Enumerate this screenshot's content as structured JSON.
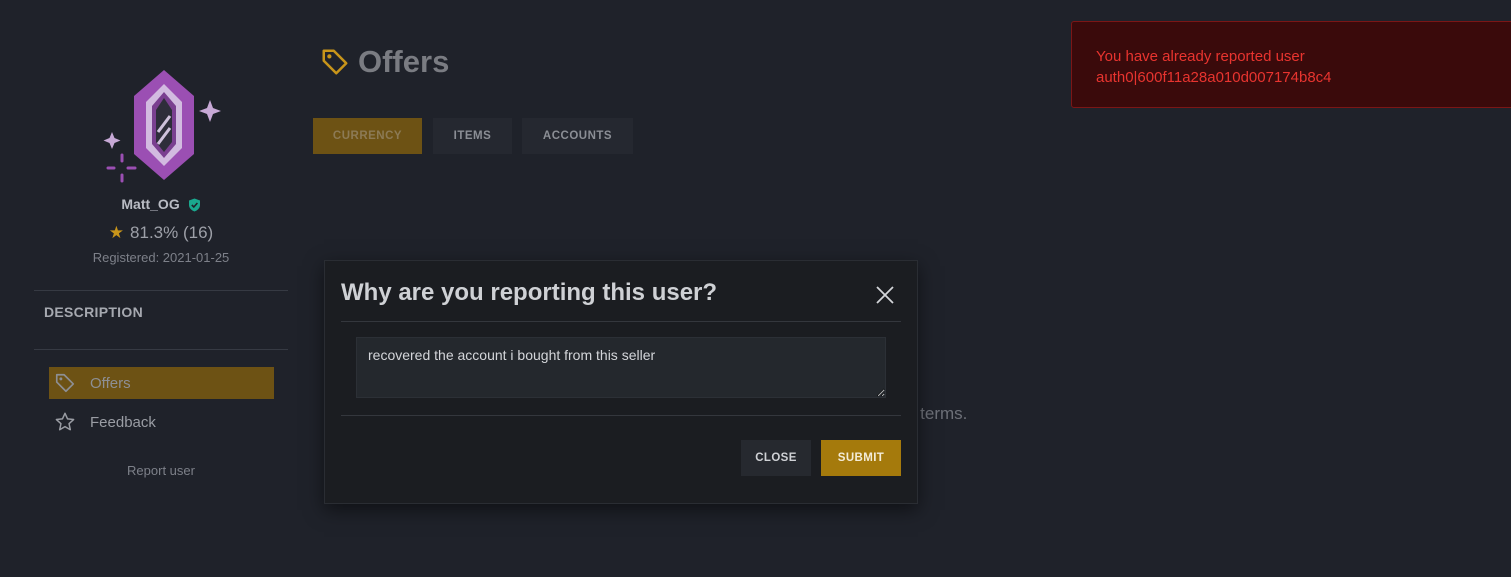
{
  "profile": {
    "username": "Matt_OG",
    "rating": "81.3% (16)",
    "registered": "Registered: 2021-01-25",
    "logo_icon": "purple-gem-logo",
    "verified_icon": "shield-check-icon"
  },
  "sidebar": {
    "description_heading": "DESCRIPTION",
    "nav": [
      {
        "label": "Offers",
        "icon": "tag-icon",
        "active": true
      },
      {
        "label": "Feedback",
        "icon": "star-outline-icon",
        "active": false
      }
    ],
    "report_link": "Report user"
  },
  "main": {
    "title": "Offers",
    "title_icon": "tag-icon",
    "tabs": [
      {
        "label": "CURRENCY",
        "active": true
      },
      {
        "label": "ITEMS",
        "active": false
      },
      {
        "label": "ACCOUNTS",
        "active": false
      }
    ],
    "background_text": "n terms."
  },
  "modal": {
    "title": "Why are you reporting this user?",
    "reason_value": "recovered the account i bought from this seller",
    "close_label": "CLOSE",
    "submit_label": "SUBMIT"
  },
  "toast": {
    "line1": "You have already reported user",
    "line2": "auth0|600f11a28a010d007174b8c4"
  },
  "colors": {
    "background": "#1f222a",
    "accent": "#a57a0c",
    "accent_dim": "#6d5214",
    "error": "#e8342f",
    "logo_purple": "#9b4fb3"
  }
}
